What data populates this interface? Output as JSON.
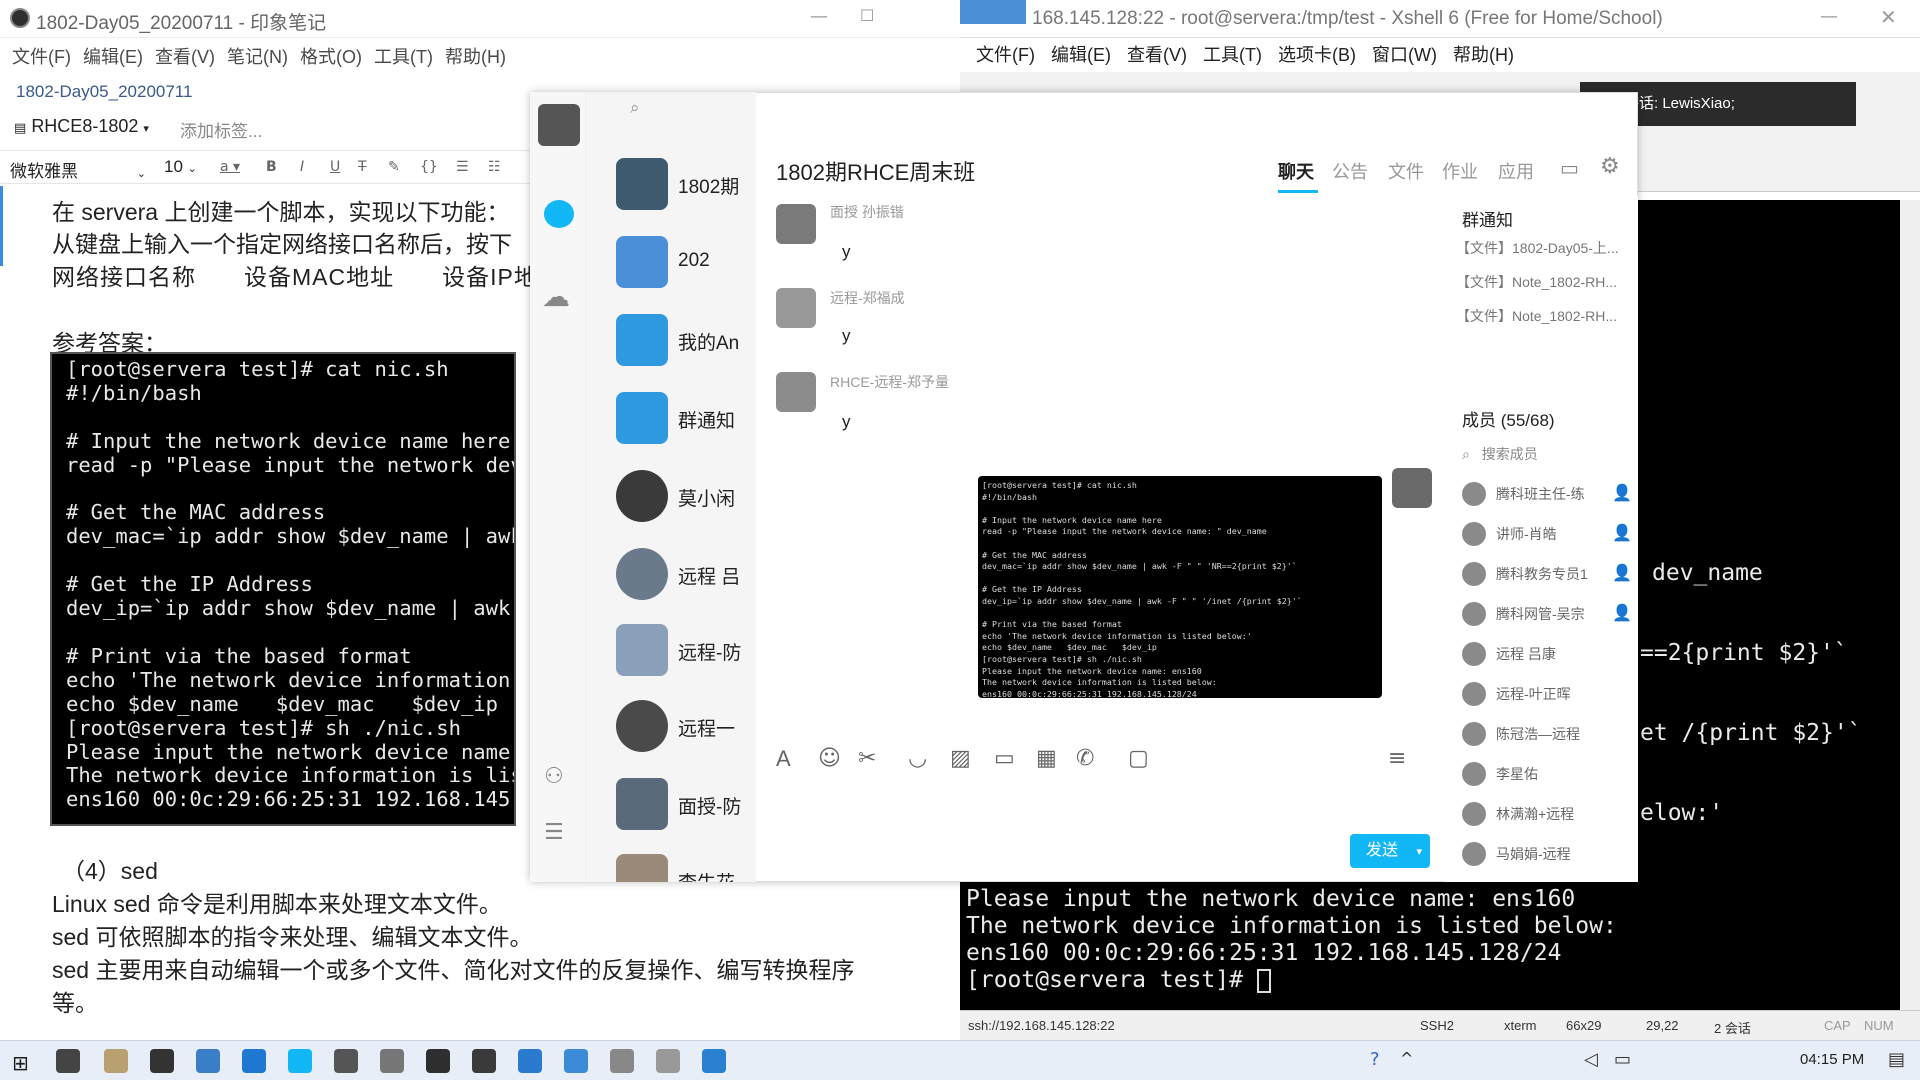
{
  "evernote": {
    "title": "1802-Day05_20200711 - 印象笔记",
    "menu": [
      "文件(F)",
      "编辑(E)",
      "查看(V)",
      "笔记(N)",
      "格式(O)",
      "工具(T)",
      "帮助(H)"
    ],
    "note_name": "1802-Day05_20200711",
    "notebook": "RHCE8-1802",
    "add_tag_placeholder": "添加标签...",
    "font": "微软雅黑",
    "font_size": "10",
    "doc_lines": [
      "在 servera 上创建一个脚本，实现以下功能：",
      "从键盘上输入一个指定网络接口名称后，按下",
      "网络接口名称　　设备MAC地址　　设备IP地",
      "参考答案："
    ],
    "code": "[root@servera test]# cat nic.sh\n#!/bin/bash\n\n# Input the network device name here\nread -p \"Please input the network dev\n\n# Get the MAC address\ndev_mac=`ip addr show $dev_name | awk\n\n# Get the IP Address\ndev_ip=`ip addr show $dev_name | awk\n\n# Print via the based format\necho 'The network device information\necho $dev_name   $dev_mac   $dev_ip\n[root@servera test]# sh ./nic.sh\nPlease input the network device name\nThe network device information is lis\nens160 00:0c:29:66:25:31 192.168.145",
    "section_sed": "（4）sed",
    "sed_lines": [
      "Linux sed 命令是利用脚本来处理文本文件。",
      "sed 可依照脚本的指令来处理、编辑文本文件。",
      "sed 主要用来自动编辑一个或多个文件、简化对文件的反复操作、编写转换程序",
      "等。"
    ]
  },
  "xshell": {
    "title": "168.145.128:22 - root@servera:/tmp/test - Xshell 6 (Free for Home/School)",
    "menu": [
      "文件(F)",
      "编辑(E)",
      "查看(V)",
      "工具(T)",
      "选项卡(B)",
      "窗口(W)",
      "帮助(H)"
    ],
    "talking": "正在讲话: LewisXiao;",
    "term_visible": [
      "dev_name",
      "==2{print $2}'`",
      "et /{print $2}'`",
      "elow:'"
    ],
    "term_bottom": [
      "Please input the network device name: ens160",
      "The network device information is listed below:",
      "ens160 00:0c:29:66:25:31 192.168.145.128/24",
      "[root@servera test]# "
    ],
    "status": {
      "conn": "ssh://192.168.145.128:22",
      "proto": "SSH2",
      "term": "xterm",
      "size": "66x29",
      "pos": "29,22",
      "sessions": "2 会话",
      "cap": "CAP",
      "num": "NUM"
    }
  },
  "qq": {
    "chat_list": [
      {
        "name": "1802期",
        "color": "#3d5a6e"
      },
      {
        "name": "202",
        "color": "#4a8fd8"
      },
      {
        "name": "我的An",
        "color": "#2f9ae0"
      },
      {
        "name": "群通知",
        "color": "#2f9ae0"
      },
      {
        "name": "莫小闲",
        "color": "#3a3a3a"
      },
      {
        "name": "远程 吕",
        "color": "#6a7a8a"
      },
      {
        "name": "远程-防",
        "color": "#8aa0b8"
      },
      {
        "name": "远程一",
        "color": "#4a4a4a"
      },
      {
        "name": "面授-防",
        "color": "#5a6a7a"
      },
      {
        "name": "李牛花",
        "color": "#9a8a7a"
      }
    ],
    "chat_title": "1802期RHCE周末班",
    "tabs": [
      "聊天",
      "公告",
      "文件",
      "作业",
      "应用"
    ],
    "messages": [
      {
        "nick": "面授 孙振锴",
        "text": "y"
      },
      {
        "nick": "远程-郑福成",
        "text": "y"
      },
      {
        "nick": "RHCE-远程-郑予量",
        "text": "y"
      }
    ],
    "shot_text": "[root@servera test]# cat nic.sh\n#!/bin/bash\n\n# Input the network device name here\nread -p \"Please input the network device name: \" dev_name\n\n# Get the MAC address\ndev_mac=`ip addr show $dev_name | awk -F \" \" 'NR==2{print $2}'`\n\n# Get the IP Address\ndev_ip=`ip addr show $dev_name | awk -F \" \" '/inet /{print $2}'`\n\n# Print via the based format\necho 'The network device information is listed below:'\necho $dev_name   $dev_mac   $dev_ip\n[root@servera test]# sh ./nic.sh\nPlease input the network device name: ens160\nThe network device information is listed below:\nens160 00:0c:29:66:25:31 192.168.145.128/24",
    "send_label": "发送",
    "group_notice_title": "群通知",
    "files": [
      "【文件】1802-Day05-上...",
      "【文件】Note_1802-RH...",
      "【文件】Note_1802-RH..."
    ],
    "members_header": "成员 (55/68)",
    "search_members": "搜索成员",
    "members": [
      "腾科班主任-练",
      "讲师-肖皓",
      "腾科教务专员1",
      "腾科网管-吴宗",
      "远程 吕康",
      "远程-叶正晖",
      "陈冠浩—远程",
      "李星佑",
      "林满瀚+远程",
      "马娟娟-远程"
    ]
  },
  "taskbar": {
    "clock": "04:15 PM"
  }
}
